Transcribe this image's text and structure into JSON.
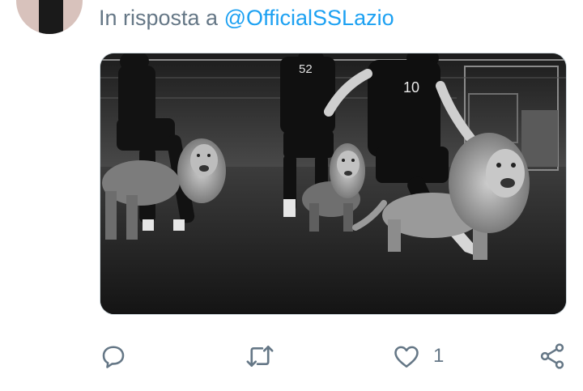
{
  "tweet": {
    "reply_prefix": "In risposta a",
    "reply_handle": "@OfficialSSLazio"
  },
  "media": {
    "alt": "Players training with lions on the pitch (black and white)",
    "jersey_numbers": [
      "52",
      "10"
    ]
  },
  "actions": {
    "reply_icon": "comment-icon",
    "retweet_icon": "retweet-icon",
    "like_icon": "heart-icon",
    "like_count": "1",
    "share_icon": "share-icon"
  },
  "colors": {
    "link": "#1da1f2",
    "secondary_text": "#657786"
  }
}
